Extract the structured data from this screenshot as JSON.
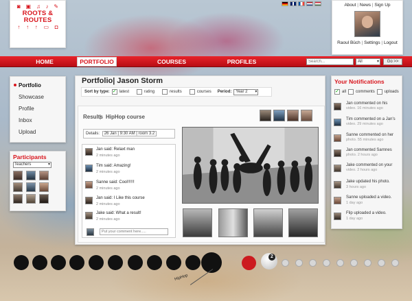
{
  "logo": {
    "brand": "ROOTS & ROUTES"
  },
  "account": {
    "about": "About",
    "news": "News",
    "signup": "Sign Up",
    "user": "Raoul Büch",
    "settings": "Settings",
    "logout": "Logout",
    "sep": "|"
  },
  "nav": {
    "home": "HOME",
    "portfolio": "PORTFOLIO",
    "courses": "COURSES",
    "profiles": "PROFILES"
  },
  "search": {
    "placeholder": "Search...",
    "select": "All",
    "go": "Go >>"
  },
  "leftmenu": {
    "items": [
      "Portfolio",
      "Showcase",
      "Profile",
      "Inbox",
      "Upload"
    ]
  },
  "participants": {
    "title": "Participants",
    "selected": "Teachers"
  },
  "main": {
    "title": "Portfolio| Jason Storm",
    "sortby": "Sort by type:",
    "filters": [
      "latest",
      "rating",
      "results",
      "courses"
    ],
    "period_label": "Period:",
    "period_value": "Year 2",
    "tabs": [
      "Results",
      "HipHop course"
    ],
    "tab_sep": "|",
    "details_label": "Details:",
    "details_value": "26 Jan | 9:30 AM | room 3.2",
    "comment_placeholder": "Put your comment here....."
  },
  "comments": [
    {
      "text": "Jan said: Relaxt man",
      "time": "2 minutes ago"
    },
    {
      "text": "Tim said: Amazing!",
      "time": "2 minutes ago"
    },
    {
      "text": "Sanne said: Cool!!!!!!",
      "time": "2 minutes ago"
    },
    {
      "text": "Jan said: I Like this course",
      "time": "2 minutes ago"
    },
    {
      "text": "Jake said: What a result!",
      "time": "2 minutes ago"
    }
  ],
  "notifications": {
    "title": "Your Notifications",
    "options": [
      "all",
      "comments",
      "uploads"
    ],
    "items": [
      {
        "text": "Jan commented on his",
        "sub": "video. 16 minutes ago"
      },
      {
        "text": "Tim commented on a Jan's",
        "sub": "video. 29 minutes ago"
      },
      {
        "text": "Sanne commented on her",
        "sub": "photo. 55 minutes ago"
      },
      {
        "text": "Jan commented Sarnnes",
        "sub": "photo. 2 hours ago"
      },
      {
        "text": "Jake commented on your",
        "sub": "video. 2 hours ago"
      },
      {
        "text": "Jake updated his photo.",
        "sub": "3 hours ago"
      },
      {
        "text": "Sanne uploaded a video.",
        "sub": "1 day ago"
      },
      {
        "text": "Flip uploaded a video.",
        "sub": "1 day ago"
      }
    ]
  },
  "timeline": {
    "badge": "2",
    "label": "HipHop"
  },
  "colors": {
    "brand_red": "#d8141c",
    "nav_red": "#e8232a"
  }
}
